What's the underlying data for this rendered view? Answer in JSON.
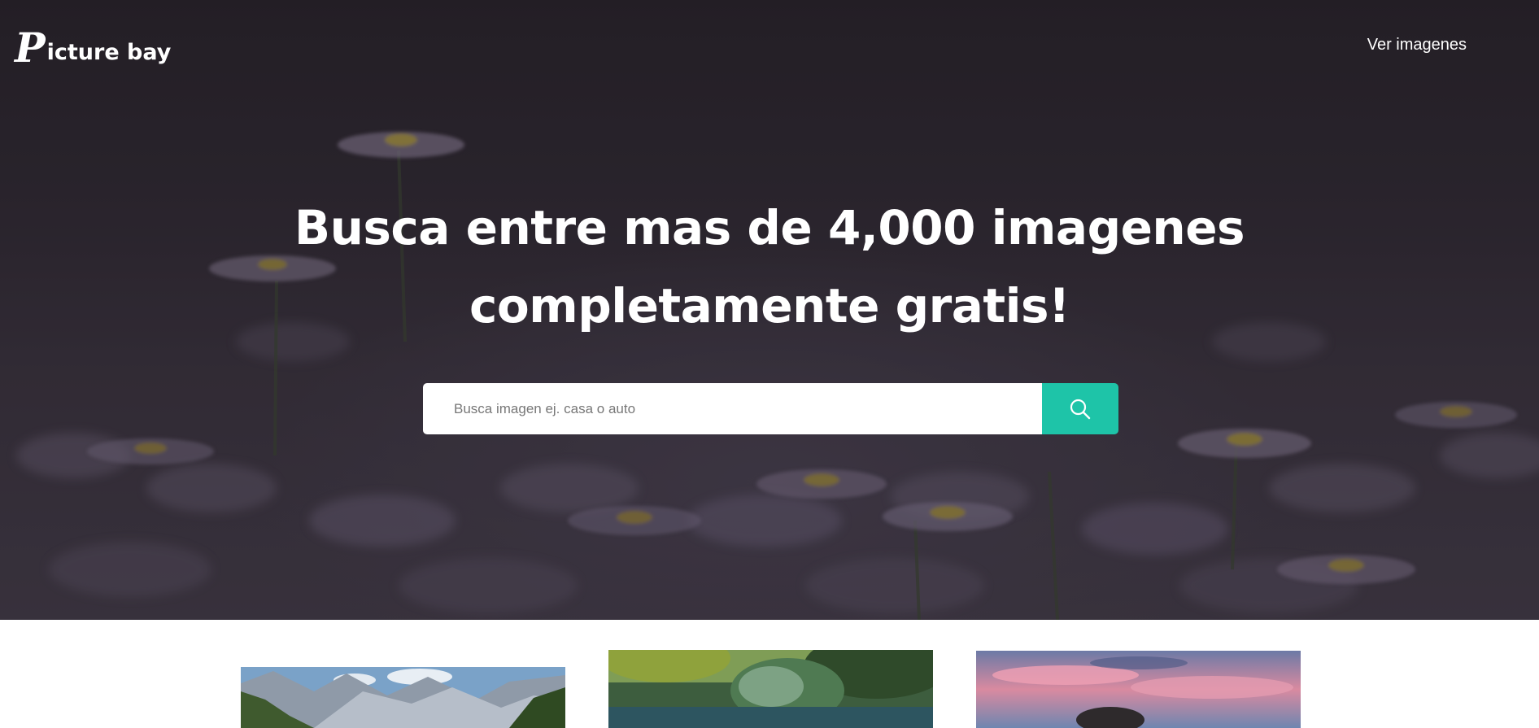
{
  "brand": {
    "logo_letter": "P",
    "logo_rest": "icture bay"
  },
  "nav": {
    "view_images": "Ver imagenes"
  },
  "hero": {
    "title_line1": "Busca entre mas de 4,000 imagenes",
    "title_line2": "completamente gratis!"
  },
  "search": {
    "placeholder": "Busca imagen ej. casa o auto",
    "value": "",
    "button_icon": "search-icon"
  },
  "colors": {
    "accent": "#1ec4a8",
    "hero_overlay": "#2b2630",
    "text_light": "#ffffff"
  }
}
